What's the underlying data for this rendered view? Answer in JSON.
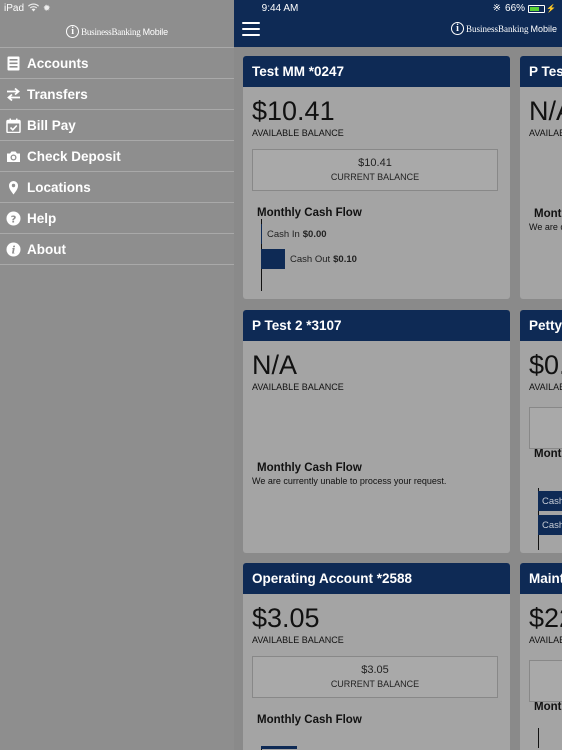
{
  "device": {
    "name": "iPad",
    "time": "9:44 AM",
    "battery": "66%"
  },
  "brand": {
    "logo_mark": "i",
    "logo_text": "BusinessBanking",
    "logo_suffix": "Mobile"
  },
  "menu": {
    "items": [
      {
        "label": "Accounts",
        "icon": "accounts-icon"
      },
      {
        "label": "Transfers",
        "icon": "transfers-icon"
      },
      {
        "label": "Bill Pay",
        "icon": "bill-pay-icon"
      },
      {
        "label": "Check Deposit",
        "icon": "camera-icon"
      },
      {
        "label": "Locations",
        "icon": "location-pin-icon"
      },
      {
        "label": "Help",
        "icon": "help-icon"
      },
      {
        "label": "About",
        "icon": "info-icon"
      }
    ]
  },
  "common": {
    "available_balance": "AVAILABLE BALANCE",
    "current_balance": "CURRENT BALANCE",
    "monthly_cash_flow": "Monthly Cash Flow",
    "cash_in": "Cash In",
    "cash_out": "Cash Out",
    "unable": "We are currently unable to process your request."
  },
  "cards": [
    {
      "title": "Test MM *0247",
      "available": "$10.41",
      "current": "$10.41",
      "cash_in": "$0.00",
      "cash_out": "$0.10"
    },
    {
      "title": "P Test 2 *3107",
      "available": "N/A"
    },
    {
      "title": "Operating Account *2588",
      "available": "$3.05",
      "current": "$3.05"
    }
  ],
  "peek_cards": [
    {
      "title": "P Tes",
      "available": "N/A",
      "label": "AVAILAE",
      "mcf": "Mont",
      "err": "We are c"
    },
    {
      "title": "Petty",
      "available": "$0.",
      "label": "AVAILAE",
      "mcf": "Mont",
      "cash": "Cash"
    },
    {
      "title": "Maint",
      "available": "$22",
      "label": "AVAILAE",
      "mcf": "Mont"
    }
  ],
  "colors": {
    "navy": "#0e2a55",
    "menu_bg": "#8e8e8e",
    "card_bg": "#a4a4a4",
    "battery": "#5ad236"
  }
}
